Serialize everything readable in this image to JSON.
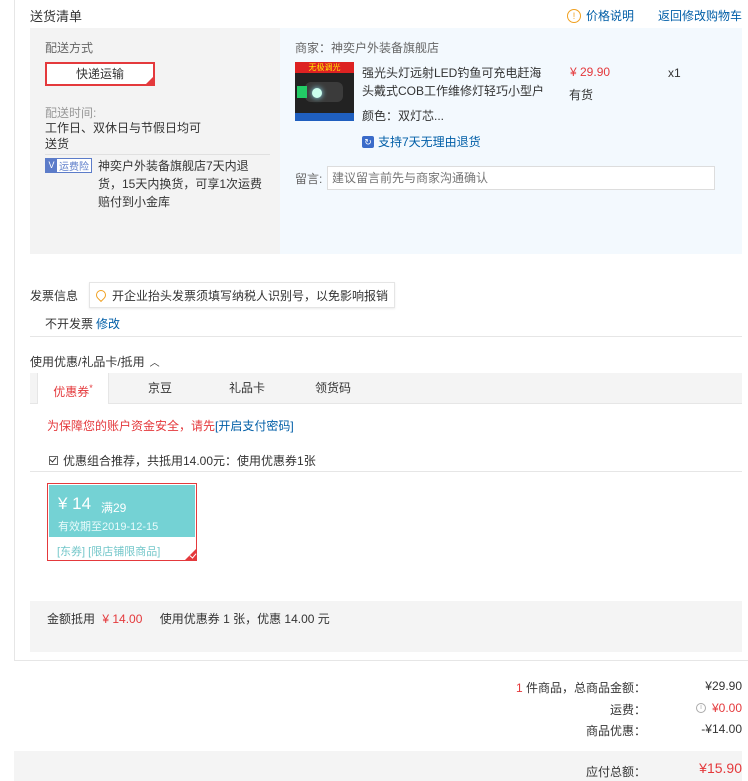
{
  "header": {
    "title": "送货清单",
    "price_note": "价格说明",
    "back_cart": "返回修改购物车"
  },
  "delivery": {
    "method_label": "配送方式",
    "method_value": "快递运输",
    "time_label": "配送时间:",
    "time_value": "工作日、双休日与节假日均可送货",
    "insurance_badge": "运费险",
    "insurance_text": "神奕户外装备旗舰店7天内退货，15天内换货，可享1次运费赔付到小金库"
  },
  "shop": {
    "label": "商家：神奕户外装备旗舰店",
    "product": {
      "image_banner": "无极调光",
      "title": "强光头灯远射LED钓鱼可充电赶海头戴式COB工作维修灯轻巧小型户",
      "color": "颜色：双灯芯...",
      "price": "¥ 29.90",
      "qty": "x1",
      "stock": "有货",
      "return_policy": "支持7天无理由退货"
    },
    "message_label": "留言:",
    "message_placeholder": "建议留言前先与商家沟通确认"
  },
  "invoice": {
    "label": "发票信息",
    "tip": "开企业抬头发票须填写纳税人识别号，以免影响报销",
    "value": "不开发票",
    "edit": "修改"
  },
  "discount": {
    "section_title": "使用优惠/礼品卡/抵用",
    "tabs": [
      "优惠券",
      "京豆",
      "礼品卡",
      "领货码"
    ],
    "tab_star": "*",
    "security_text": "为保障您的账户资金安全，请先",
    "security_link": "[开启支付密码]",
    "recommend_text": "优惠组合推荐，共抵用14.00元：使用优惠券1张",
    "coupon": {
      "amount": "¥ 14",
      "condition": "满29",
      "expiry": "有效期至2019-12-15",
      "tags": "[东券]  [限店铺限商品]"
    },
    "summary_label": "金额抵用",
    "summary_amount": "¥ 14.00",
    "summary_text": "使用优惠券 1 张，优惠 14.00 元"
  },
  "totals": {
    "count": "1",
    "count_label": "件商品，总商品金额：",
    "goods_total": "¥29.90",
    "freight_label": "运费：",
    "freight_value": "¥0.00",
    "discount_label": "商品优惠：",
    "discount_value": "-¥14.00",
    "payable_label": "应付总额：",
    "payable_value": "¥15.90"
  },
  "colors": {
    "accent_red": "#e4393c",
    "link_blue": "#005ea7",
    "coupon_teal": "#74d2d4"
  }
}
